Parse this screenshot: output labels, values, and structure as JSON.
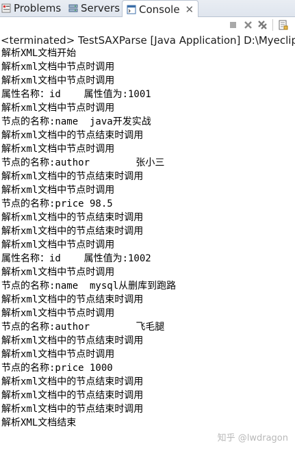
{
  "tabs": [
    {
      "label": "Problems",
      "active": false
    },
    {
      "label": "Servers",
      "active": false
    },
    {
      "label": "Console",
      "active": true,
      "close": "✕"
    }
  ],
  "console": {
    "header": "<terminated> TestSAXParse [Java Application] D:\\Myeclipse",
    "lines": [
      "解析XML文档开始",
      "解析xml文档中节点时调用",
      "解析xml文档中节点时调用",
      "属性名称：id    属性值为:1001",
      "解析xml文档中节点时调用",
      "节点的名称:name  java开发实战",
      "解析xml文档中的节点结束时调用",
      "解析xml文档中节点时调用",
      "节点的名称:author        张小三",
      "解析xml文档中的节点结束时调用",
      "解析xml文档中节点时调用",
      "节点的名称:price 98.5",
      "解析xml文档中的节点结束时调用",
      "解析xml文档中的节点结束时调用",
      "解析xml文档中节点时调用",
      "属性名称：id    属性值为:1002",
      "解析xml文档中节点时调用",
      "节点的名称:name  mysql从删库到跑路",
      "解析xml文档中的节点结束时调用",
      "解析xml文档中节点时调用",
      "节点的名称:author        飞毛腿",
      "解析xml文档中的节点结束时调用",
      "解析xml文档中节点时调用",
      "节点的名称:price 1000",
      "解析xml文档中的节点结束时调用",
      "解析xml文档中的节点结束时调用",
      "解析xml文档中的节点结束时调用",
      "解析XML文档结束"
    ]
  },
  "watermark": "知乎 @lwdragon"
}
